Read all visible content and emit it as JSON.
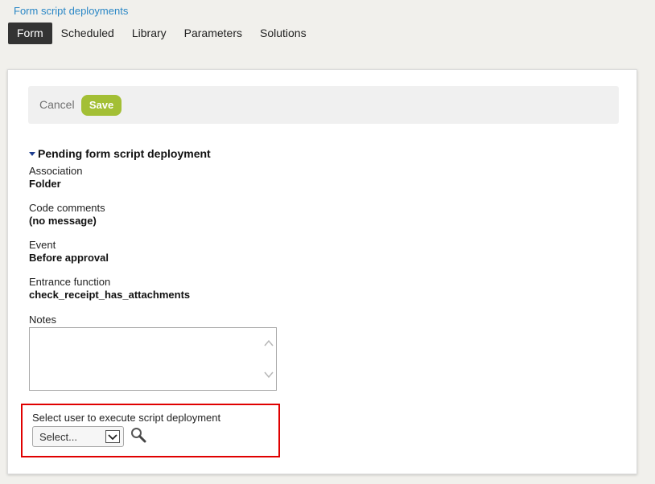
{
  "header": {
    "breadcrumb": "Form script deployments",
    "tabs": [
      {
        "label": "Form",
        "active": true
      },
      {
        "label": "Scheduled",
        "active": false
      },
      {
        "label": "Library",
        "active": false
      },
      {
        "label": "Parameters",
        "active": false
      },
      {
        "label": "Solutions",
        "active": false
      }
    ]
  },
  "toolbar": {
    "cancel_label": "Cancel",
    "save_label": "Save"
  },
  "section": {
    "title": "Pending form script deployment",
    "fields": [
      {
        "label": "Association",
        "value": "Folder"
      },
      {
        "label": "Code comments",
        "value": "(no message)"
      },
      {
        "label": "Event",
        "value": "Before approval"
      },
      {
        "label": "Entrance function",
        "value": "check_receipt_has_attachments"
      }
    ],
    "notes_label": "Notes",
    "notes_value": ""
  },
  "user_select": {
    "label": "Select user to execute script deployment",
    "selected": "Select..."
  },
  "colors": {
    "accent_save": "#a3bf35",
    "breadcrumb_link": "#2a87c6",
    "highlight": "#e00000",
    "active_tab": "#333333"
  },
  "icons": [
    "caret-down-icon",
    "chevron-up-icon",
    "chevron-down-icon",
    "dropdown-arrow-icon",
    "search-icon"
  ]
}
